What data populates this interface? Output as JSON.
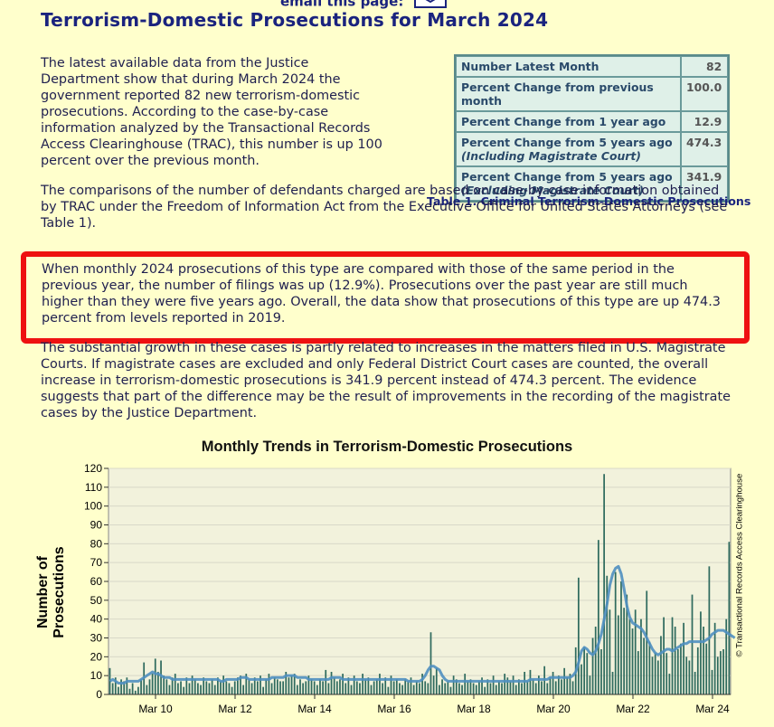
{
  "header": {
    "email_link": "email this page:",
    "title": "Terrorism-Domestic Prosecutions for March 2024"
  },
  "article": {
    "p1": "The latest available data from the Justice Department show that during March 2024 the government reported 82 new terrorism-domestic prosecutions. According to the case-by-case information analyzed by the Transactional Records Access Clearinghouse (TRAC), this number is up 100 percent over the previous month.",
    "p2": "The comparisons of the number of defendants charged are based on case-by-case information obtained by TRAC under the Freedom of Information Act from the Executive Office for United States Attorneys (see Table 1).",
    "p3": "When monthly 2024 prosecutions of this type are compared with those of the same period in the previous year, the number of filings was up (12.9%). Prosecutions over the past year are still much higher than they were five years ago. Overall, the data show that prosecutions of this type are up 474.3 percent from levels reported in 2019.",
    "p4": "The substantial growth in these cases is partly related to increases in the matters filed in U.S. Magistrate Courts. If magistrate cases are excluded and only Federal District Court cases are counted, the overall increase in terrorism-domestic prosecutions is 341.9 percent instead of 474.3 percent. The evidence suggests that part of the difference may be the result of improvements in the recording of the magistrate cases by the Justice Department."
  },
  "table": {
    "caption": "Table 1. Criminal Terrorism-Domestic Prosecutions",
    "rows": [
      {
        "label": "Number Latest Month",
        "sub": "",
        "value": "82"
      },
      {
        "label": "Percent Change from previous month",
        "sub": "",
        "value": "100.0"
      },
      {
        "label": "Percent Change from 1 year ago",
        "sub": "",
        "value": "12.9"
      },
      {
        "label": "Percent Change from 5 years ago",
        "sub": "(Including Magistrate Court)",
        "value": "474.3"
      },
      {
        "label": "Percent Change from 5 years ago",
        "sub": "(Excluding Magistrate Court)",
        "value": "341.9"
      }
    ]
  },
  "colors": {
    "page_bg": "#ffffcc",
    "plot_bg": "#f2f2dc",
    "bar": "#2f6b5e",
    "trend": "#4f8fc0",
    "callout": "#ee1111"
  },
  "chart_data": {
    "type": "bar",
    "title": "Monthly Trends in Terrorism-Domestic Prosecutions",
    "ylabel": "Number of Prosecutions",
    "xlabel": "",
    "credit": "© Transactional Records Access Clearinghouse",
    "ylim": [
      0,
      120
    ],
    "yticks": [
      0,
      10,
      20,
      30,
      40,
      50,
      60,
      70,
      80,
      90,
      100,
      110,
      120
    ],
    "x_tick_labels": [
      "Mar 10",
      "Mar 12",
      "Mar 14",
      "Mar 16",
      "Mar 18",
      "Mar 20",
      "Mar 22",
      "Mar 24"
    ],
    "grid": true,
    "series": [
      {
        "kind": "bar",
        "values": [
          14,
          6,
          9,
          4,
          8,
          7,
          9,
          3,
          6,
          2,
          4,
          8,
          17,
          5,
          8,
          11,
          19,
          12,
          18,
          10,
          8,
          5,
          9,
          11,
          6,
          7,
          4,
          9,
          6,
          10,
          8,
          6,
          5,
          9,
          7,
          6,
          8,
          5,
          9,
          7,
          10,
          7,
          6,
          4,
          7,
          9,
          10,
          5,
          11,
          8,
          6,
          9,
          7,
          10,
          4,
          8,
          11,
          6,
          9,
          8,
          7,
          7,
          12,
          9,
          10,
          11,
          5,
          8,
          6,
          7,
          10,
          8,
          7,
          5,
          8,
          7,
          13,
          6,
          12,
          9,
          7,
          8,
          11,
          6,
          9,
          5,
          10,
          7,
          6,
          11,
          8,
          9,
          5,
          7,
          8,
          11,
          6,
          9,
          4,
          10,
          7,
          8,
          6,
          5,
          8,
          7,
          9,
          5,
          7,
          6,
          11,
          7,
          6,
          33,
          10,
          14,
          5,
          8,
          6,
          7,
          4,
          10,
          8,
          6,
          5,
          11,
          7,
          8,
          6,
          5,
          7,
          9,
          4,
          8,
          6,
          10,
          5,
          7,
          6,
          11,
          9,
          7,
          10,
          5,
          8,
          6,
          12,
          7,
          13,
          8,
          6,
          10,
          7,
          15,
          6,
          9,
          12,
          7,
          10,
          8,
          14,
          9,
          11,
          7,
          25,
          62,
          16,
          25,
          22,
          10,
          30,
          36,
          82,
          24,
          117,
          63,
          45,
          12,
          65,
          42,
          60,
          46,
          53,
          40,
          35,
          45,
          23,
          40,
          30,
          55,
          28,
          20,
          22,
          18,
          31,
          41,
          22,
          11,
          41,
          36,
          24,
          27,
          38,
          20,
          18,
          53,
          12,
          25,
          44,
          36,
          27,
          68,
          13,
          38,
          20,
          23,
          24,
          40,
          81
        ],
        "trend": [
          7,
          8,
          7,
          6,
          6,
          6,
          7,
          7,
          7,
          7,
          7,
          8,
          9,
          10,
          11,
          12,
          11,
          11,
          10,
          9,
          9,
          9,
          8,
          8,
          8,
          8,
          8,
          8,
          8,
          8,
          8,
          8,
          8,
          8,
          8,
          8,
          8,
          8,
          8,
          7,
          7,
          8,
          8,
          8,
          8,
          8,
          9,
          9,
          9,
          8,
          8,
          8,
          8,
          8,
          8,
          8,
          8,
          9,
          9,
          9,
          9,
          9,
          10,
          10,
          10,
          10,
          9,
          9,
          9,
          9,
          8,
          8,
          8,
          8,
          8,
          8,
          8,
          8,
          9,
          9,
          9,
          9,
          8,
          8,
          8,
          8,
          8,
          8,
          8,
          8,
          8,
          8,
          8,
          8,
          8,
          8,
          8,
          8,
          8,
          8,
          8,
          8,
          8,
          8,
          8,
          7,
          7,
          7,
          7,
          7,
          8,
          10,
          13,
          15,
          15,
          14,
          13,
          10,
          8,
          7,
          7,
          7,
          7,
          7,
          7,
          7,
          7,
          7,
          7,
          7,
          7,
          7,
          7,
          7,
          7,
          7,
          7,
          7,
          7,
          7,
          7,
          7,
          7,
          7,
          7,
          7,
          7,
          7,
          8,
          8,
          8,
          8,
          8,
          8,
          8,
          9,
          9,
          9,
          9,
          9,
          9,
          9,
          9,
          10,
          12,
          17,
          23,
          25,
          24,
          22,
          21,
          23,
          27,
          32,
          40,
          48,
          58,
          64,
          67,
          68,
          64,
          56,
          47,
          41,
          38,
          37,
          36,
          35,
          33,
          30,
          27,
          24,
          22,
          21,
          22,
          23,
          24,
          24,
          23,
          24,
          25,
          26,
          27,
          27,
          28,
          28,
          28,
          28,
          28,
          28,
          29,
          30,
          32,
          33,
          34,
          34,
          34,
          33,
          32,
          31,
          30
        ]
      }
    ]
  }
}
